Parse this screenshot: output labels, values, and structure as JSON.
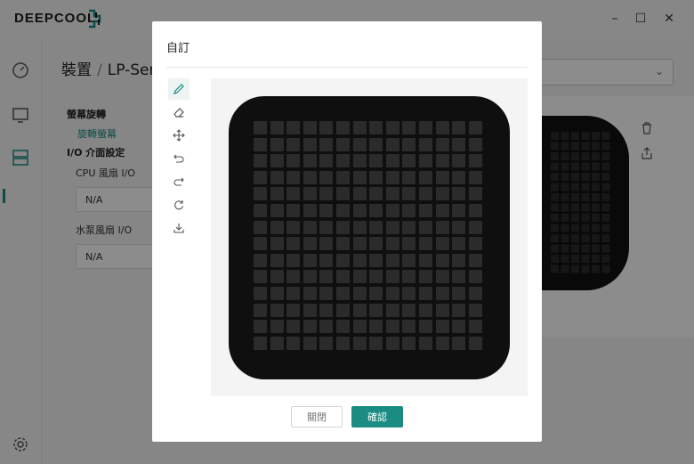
{
  "app": {
    "brand": "DEEPCOOL",
    "window_controls": {
      "minimize": "–",
      "maximize": "☐",
      "close": "✕"
    }
  },
  "main": {
    "breadcrumb": {
      "parent": "裝置",
      "separator": "/",
      "current": "LP-Ser"
    },
    "screen_rotation": {
      "title": "螢幕旋轉",
      "link": "旋轉螢幕"
    },
    "io_settings": {
      "title": "I/O 介面設定",
      "cpu_fan": {
        "label": "CPU 風扇 I/O",
        "value": "N/A"
      },
      "pump_fan": {
        "label": "水泵風扇 I/O",
        "value": "N/A"
      }
    }
  },
  "modal": {
    "title": "自訂",
    "tools": [
      {
        "name": "pencil-tool",
        "icon": "pencil-icon"
      },
      {
        "name": "eraser-tool",
        "icon": "eraser-icon"
      },
      {
        "name": "move-tool",
        "icon": "move-icon"
      },
      {
        "name": "undo-tool",
        "icon": "undo-icon"
      },
      {
        "name": "redo-tool",
        "icon": "redo-icon"
      },
      {
        "name": "reset-tool",
        "icon": "refresh-icon"
      },
      {
        "name": "download-tool",
        "icon": "download-icon"
      }
    ],
    "close_label": "關閉",
    "confirm_label": "確認"
  },
  "colors": {
    "accent": "#1a8c82",
    "device": "#0f0f0f",
    "led_off": "#2b2b2b"
  }
}
